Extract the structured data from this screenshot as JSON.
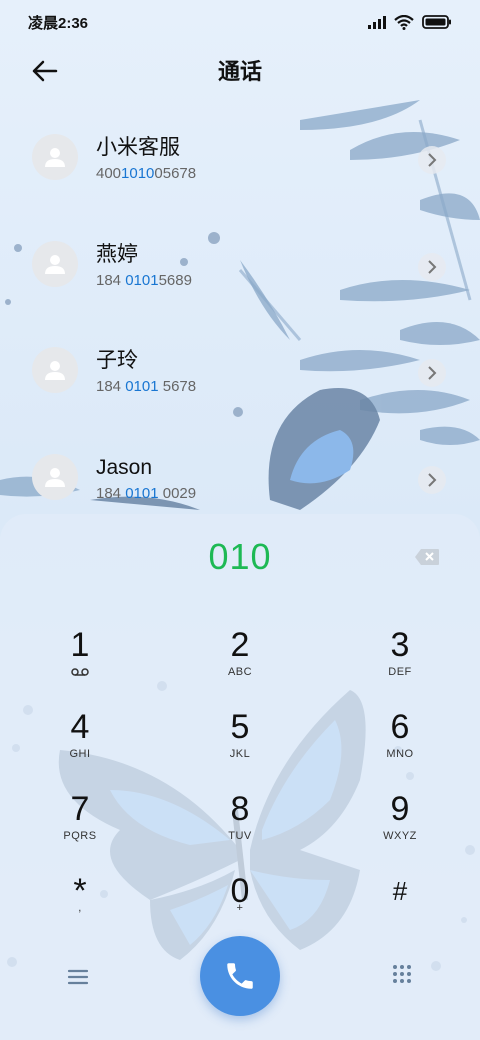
{
  "status_bar": {
    "time": "凌晨2:36"
  },
  "header": {
    "title": "通话"
  },
  "contacts": [
    {
      "name": "小米客服",
      "number_pre": "400",
      "number_hl": "1010",
      "number_post": "05678"
    },
    {
      "name": "燕婷",
      "number_pre": "184 ",
      "number_hl": "0101",
      "number_post": "5689"
    },
    {
      "name": "子玲",
      "number_pre": "184 ",
      "number_hl": "0101",
      "number_post": " 5678"
    },
    {
      "name": "Jason",
      "number_pre": "184 ",
      "number_hl": "0101",
      "number_post": " 0029"
    }
  ],
  "dialpad": {
    "display": "010",
    "keys": [
      {
        "digit": "1",
        "letters": ""
      },
      {
        "digit": "2",
        "letters": "ABC"
      },
      {
        "digit": "3",
        "letters": "DEF"
      },
      {
        "digit": "4",
        "letters": "GHI"
      },
      {
        "digit": "5",
        "letters": "JKL"
      },
      {
        "digit": "6",
        "letters": "MNO"
      },
      {
        "digit": "7",
        "letters": "PQRS"
      },
      {
        "digit": "8",
        "letters": "TUV"
      },
      {
        "digit": "9",
        "letters": "WXYZ"
      },
      {
        "digit": "*",
        "letters": ","
      },
      {
        "digit": "0",
        "letters": "+"
      },
      {
        "digit": "#",
        "letters": ""
      }
    ]
  },
  "colors": {
    "accent": "#4a90e2",
    "dial_text": "#1db954",
    "highlight": "#1976d2"
  }
}
